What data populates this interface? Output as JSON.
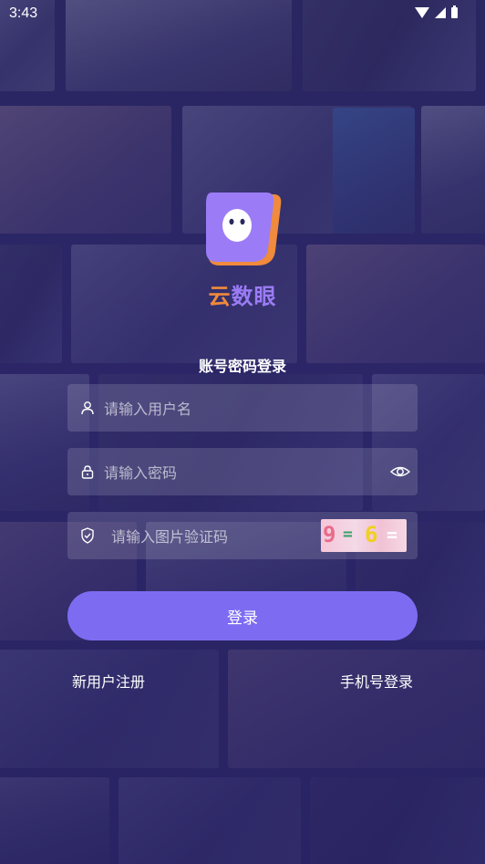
{
  "status_bar": {
    "time": "3:43"
  },
  "brand": {
    "name_part1": "云",
    "name_part2": "数眼"
  },
  "form": {
    "title": "账号密码登录",
    "username_placeholder": "请输入用户名",
    "password_placeholder": "请输入密码",
    "captcha_placeholder": "请输入图片验证码",
    "captcha_chars": [
      "9",
      "=",
      "6",
      "="
    ]
  },
  "actions": {
    "login_label": "登录",
    "register_label": "新用户注册",
    "phone_login_label": "手机号登录"
  },
  "colors": {
    "accent": "#7d6cf2",
    "brand_orange": "#f08a3c",
    "brand_purple": "#9b7cf6",
    "background": "#2b2760"
  },
  "icons": [
    "wifi-icon",
    "signal-icon",
    "battery-icon",
    "user-icon",
    "lock-icon",
    "eye-icon",
    "shield-icon"
  ]
}
